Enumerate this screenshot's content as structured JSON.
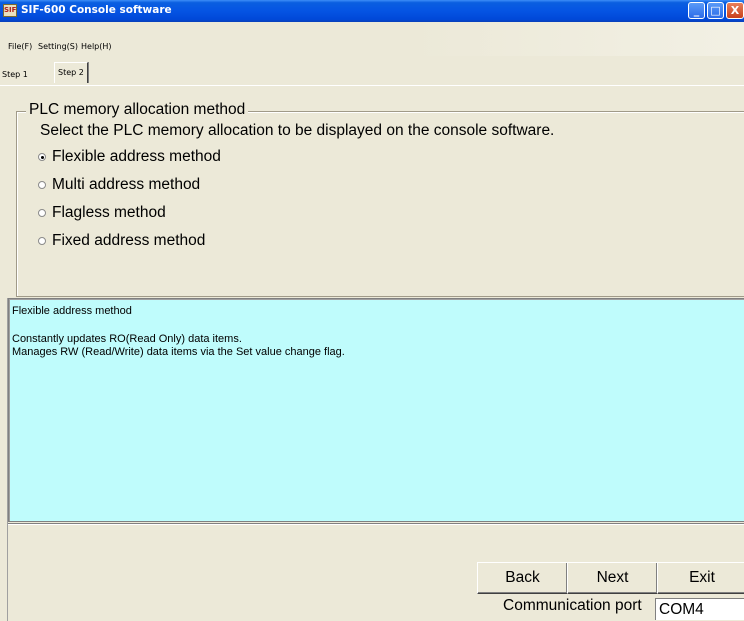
{
  "window": {
    "icon_text": "SIF",
    "title": "SIF-600 Console software",
    "minimize_glyph": "_",
    "maximize_glyph": "□",
    "close_glyph": "X"
  },
  "menu": {
    "items": [
      "File(F)",
      "Setting(S)",
      "Help(H)"
    ]
  },
  "tabs": {
    "items": [
      "Step 1",
      "Step 2"
    ],
    "active": "Step 2"
  },
  "allocation": {
    "group_title": "PLC memory allocation method",
    "instruction": "Select the PLC memory allocation to be displayed on the console software.",
    "options": [
      {
        "label": "Flexible address method",
        "selected": true
      },
      {
        "label": "Multi address method",
        "selected": false
      },
      {
        "label": "Flagless method",
        "selected": false
      },
      {
        "label": "Fixed address method",
        "selected": false
      }
    ]
  },
  "description": {
    "title": "Flexible address method",
    "line1": "Constantly updates RO(Read Only) data items.",
    "line2": "Manages RW (Read/Write) data items via the Set value change flag.",
    "background": "#bffcfc"
  },
  "buttons": {
    "back": "Back",
    "next": "Next",
    "exit": "Exit"
  },
  "port": {
    "label": "Communication port",
    "value": "COM4"
  }
}
